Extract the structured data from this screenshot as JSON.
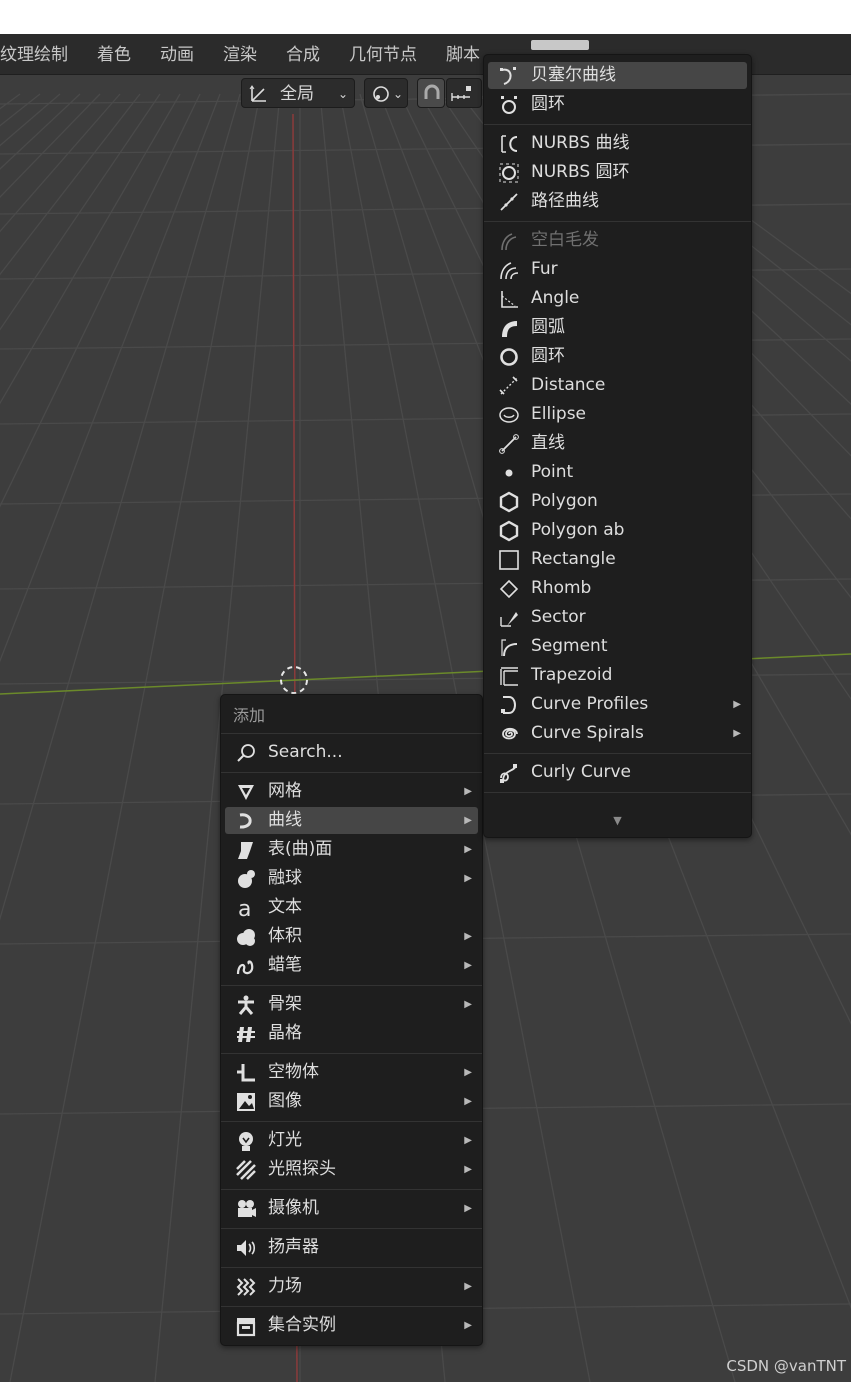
{
  "workspace_tabs": [
    "纹理绘制",
    "着色",
    "动画",
    "渲染",
    "合成",
    "几何节点",
    "脚本"
  ],
  "header": {
    "transform_orientation": "全局"
  },
  "add_menu": {
    "title": "添加",
    "search": "Search...",
    "groups": [
      [
        {
          "label": "网格",
          "icon": "mesh-icon",
          "submenu": true
        },
        {
          "label": "曲线",
          "icon": "curve-icon",
          "submenu": true,
          "highlighted": true
        },
        {
          "label": "表(曲)面",
          "icon": "surface-icon",
          "submenu": true
        },
        {
          "label": "融球",
          "icon": "metaball-icon",
          "submenu": true
        },
        {
          "label": "文本",
          "icon": "text-icon",
          "submenu": false
        },
        {
          "label": "体积",
          "icon": "volume-icon",
          "submenu": true
        },
        {
          "label": "蜡笔",
          "icon": "grease-pencil-icon",
          "submenu": true
        }
      ],
      [
        {
          "label": "骨架",
          "icon": "armature-icon",
          "submenu": true
        },
        {
          "label": "晶格",
          "icon": "lattice-icon",
          "submenu": false
        }
      ],
      [
        {
          "label": "空物体",
          "icon": "empty-icon",
          "submenu": true
        },
        {
          "label": "图像",
          "icon": "image-icon",
          "submenu": true
        }
      ],
      [
        {
          "label": "灯光",
          "icon": "light-icon",
          "submenu": true
        },
        {
          "label": "光照探头",
          "icon": "light-probe-icon",
          "submenu": true
        }
      ],
      [
        {
          "label": "摄像机",
          "icon": "camera-icon",
          "submenu": true
        }
      ],
      [
        {
          "label": "扬声器",
          "icon": "speaker-icon",
          "submenu": false
        }
      ],
      [
        {
          "label": "力场",
          "icon": "force-field-icon",
          "submenu": true
        }
      ],
      [
        {
          "label": "集合实例",
          "icon": "collection-instance-icon",
          "submenu": true
        }
      ]
    ]
  },
  "curve_menu": {
    "groups": [
      [
        {
          "label": "贝塞尔曲线",
          "icon": "bezier-curve-icon",
          "highlighted": true
        },
        {
          "label": "圆环",
          "icon": "bezier-circle-icon"
        }
      ],
      [
        {
          "label": "NURBS 曲线",
          "icon": "nurbs-curve-icon"
        },
        {
          "label": "NURBS 圆环",
          "icon": "nurbs-circle-icon"
        },
        {
          "label": "路径曲线",
          "icon": "path-curve-icon"
        }
      ],
      [
        {
          "label": "空白毛发",
          "icon": "empty-hair-icon",
          "disabled": true
        },
        {
          "label": "Fur",
          "icon": "fur-icon"
        },
        {
          "label": "Angle",
          "icon": "angle-icon"
        },
        {
          "label": "圆弧",
          "icon": "arc-icon"
        },
        {
          "label": "圆环",
          "icon": "circle-icon"
        },
        {
          "label": "Distance",
          "icon": "distance-icon"
        },
        {
          "label": "Ellipse",
          "icon": "ellipse-icon"
        },
        {
          "label": "直线",
          "icon": "line-icon"
        },
        {
          "label": "Point",
          "icon": "point-icon"
        },
        {
          "label": "Polygon",
          "icon": "polygon-icon"
        },
        {
          "label": "Polygon ab",
          "icon": "polygon-ab-icon"
        },
        {
          "label": "Rectangle",
          "icon": "rectangle-icon"
        },
        {
          "label": "Rhomb",
          "icon": "rhomb-icon"
        },
        {
          "label": "Sector",
          "icon": "sector-icon"
        },
        {
          "label": "Segment",
          "icon": "segment-icon"
        },
        {
          "label": "Trapezoid",
          "icon": "trapezoid-icon"
        },
        {
          "label": "Curve Profiles",
          "icon": "curve-profiles-icon",
          "submenu": true
        },
        {
          "label": "Curve Spirals",
          "icon": "curve-spirals-icon",
          "submenu": true
        }
      ],
      [
        {
          "label": "Curly Curve",
          "icon": "curly-curve-icon"
        }
      ]
    ],
    "more_indicator": "▼"
  },
  "watermark": "CSDN @vanTNT",
  "colors": {
    "viewport_bg": "#3d3d3d",
    "grid_line": "#4a4a4a",
    "x_axis": "#8b3b3b",
    "y_axis": "#6b8a2a",
    "menu_bg": "#1e1e1e",
    "highlight": "#464646"
  }
}
